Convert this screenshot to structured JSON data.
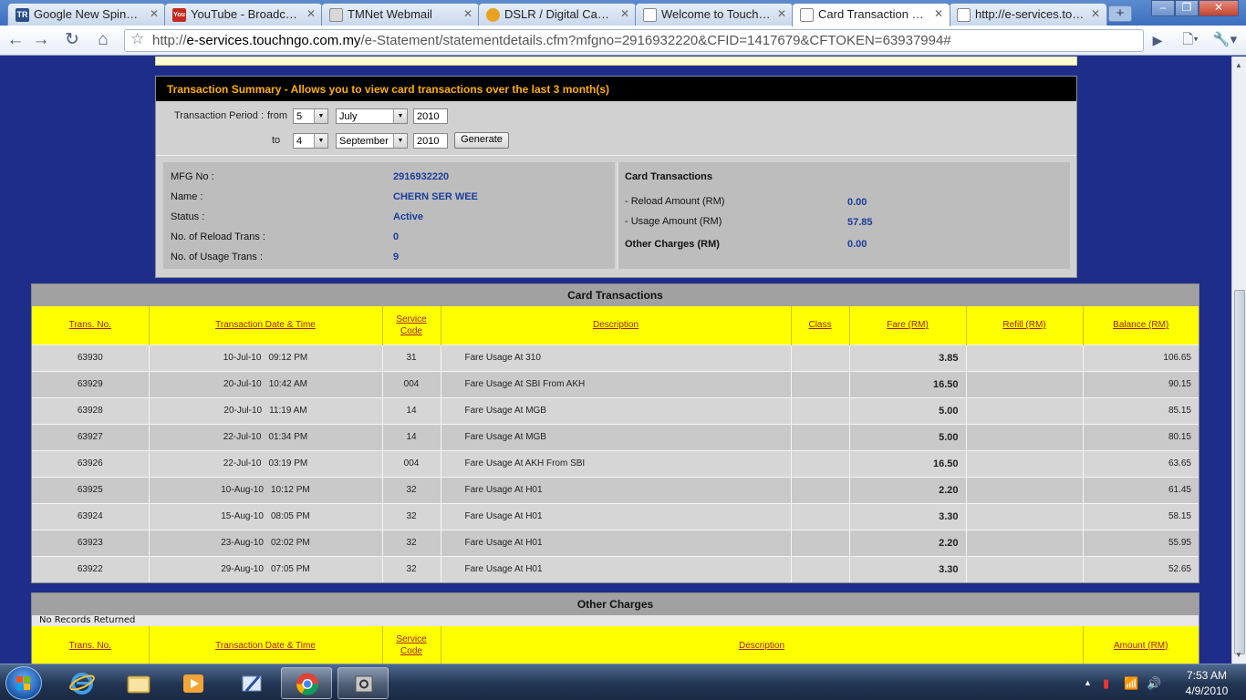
{
  "browser": {
    "tabs": [
      {
        "label": "Google New Spinnin...",
        "favicon": "TR"
      },
      {
        "label": "YouTube - Broadcast...",
        "favicon": "You"
      },
      {
        "label": "TMNet Webmail",
        "favicon": ""
      },
      {
        "label": "DSLR / Digital Camer...",
        "favicon": ""
      },
      {
        "label": "Welcome to Touch'n...",
        "favicon": ""
      },
      {
        "label": "Card Transaction Det...",
        "favicon": ""
      },
      {
        "label": "http://e-services.tou...",
        "favicon": ""
      }
    ],
    "url_prefix": "http://",
    "url_host": "e-services.touchngo.com.my",
    "url_path": "/e-Statement/statementdetails.cfm?mfgno=2916932220&CFID=1417679&CFTOKEN=63937994#"
  },
  "summary": {
    "header": "Transaction Summary - Allows you to view card transactions over the last 3 month(s)",
    "period_label": "Transaction Period :",
    "from_label": "from",
    "to_label": "to",
    "from_day": "5",
    "from_month": "July",
    "from_year": "2010",
    "to_day": "4",
    "to_month": "September",
    "to_year": "2010",
    "generate_label": "Generate"
  },
  "info": {
    "mfg_label": "MFG No :",
    "mfg_value": "2916932220",
    "name_label": "Name :",
    "name_value": "CHERN SER WEE",
    "status_label": "Status :",
    "status_value": "Active",
    "reload_label": "No. of Reload Trans :",
    "reload_value": "0",
    "usage_label": "No. of Usage Trans :",
    "usage_value": "9"
  },
  "card_summary": {
    "title": "Card Transactions",
    "reload_label": "- Reload Amount (RM)",
    "reload_value": "0.00",
    "usage_label": "- Usage Amount (RM)",
    "usage_value": "57.85",
    "other_label": "Other Charges (RM)",
    "other_value": "0.00"
  },
  "transactions": {
    "caption": "Card Transactions",
    "headers": [
      "Trans. No.",
      "Transaction Date & Time",
      "Service Code",
      "Description",
      "Class",
      "Fare (RM)",
      "Refill (RM)",
      "Balance (RM)"
    ],
    "rows": [
      {
        "no": "63930",
        "date": "10-Jul-10",
        "time": "09:12 PM",
        "code": "31",
        "desc": "Fare Usage At 310",
        "cls": "",
        "fare": "3.85",
        "refill": "",
        "balance": "106.65"
      },
      {
        "no": "63929",
        "date": "20-Jul-10",
        "time": "10:42 AM",
        "code": "004",
        "desc": "Fare Usage At SBI From AKH",
        "cls": "",
        "fare": "16.50",
        "refill": "",
        "balance": "90.15"
      },
      {
        "no": "63928",
        "date": "20-Jul-10",
        "time": "11:19 AM",
        "code": "14",
        "desc": "Fare Usage At MGB",
        "cls": "",
        "fare": "5.00",
        "refill": "",
        "balance": "85.15"
      },
      {
        "no": "63927",
        "date": "22-Jul-10",
        "time": "01:34 PM",
        "code": "14",
        "desc": "Fare Usage At MGB",
        "cls": "",
        "fare": "5.00",
        "refill": "",
        "balance": "80.15"
      },
      {
        "no": "63926",
        "date": "22-Jul-10",
        "time": "03:19 PM",
        "code": "004",
        "desc": "Fare Usage At AKH From SBI",
        "cls": "",
        "fare": "16.50",
        "refill": "",
        "balance": "63.65"
      },
      {
        "no": "63925",
        "date": "10-Aug-10",
        "time": "10:12 PM",
        "code": "32",
        "desc": "Fare Usage At H01",
        "cls": "",
        "fare": "2.20",
        "refill": "",
        "balance": "61.45"
      },
      {
        "no": "63924",
        "date": "15-Aug-10",
        "time": "08:05 PM",
        "code": "32",
        "desc": "Fare Usage At H01",
        "cls": "",
        "fare": "3.30",
        "refill": "",
        "balance": "58.15"
      },
      {
        "no": "63923",
        "date": "23-Aug-10",
        "time": "02:02 PM",
        "code": "32",
        "desc": "Fare Usage At H01",
        "cls": "",
        "fare": "2.20",
        "refill": "",
        "balance": "55.95"
      },
      {
        "no": "63922",
        "date": "29-Aug-10",
        "time": "07:05 PM",
        "code": "32",
        "desc": "Fare Usage At H01",
        "cls": "",
        "fare": "3.30",
        "refill": "",
        "balance": "52.65"
      }
    ]
  },
  "other_charges": {
    "caption": "Other Charges",
    "empty_text": "No Records Returned",
    "headers": [
      "Trans. No.",
      "Transaction Date & Time",
      "Service Code",
      "Description",
      "Amount (RM)"
    ]
  },
  "taskbar": {
    "time": "7:53 AM",
    "date": "4/9/2010"
  }
}
